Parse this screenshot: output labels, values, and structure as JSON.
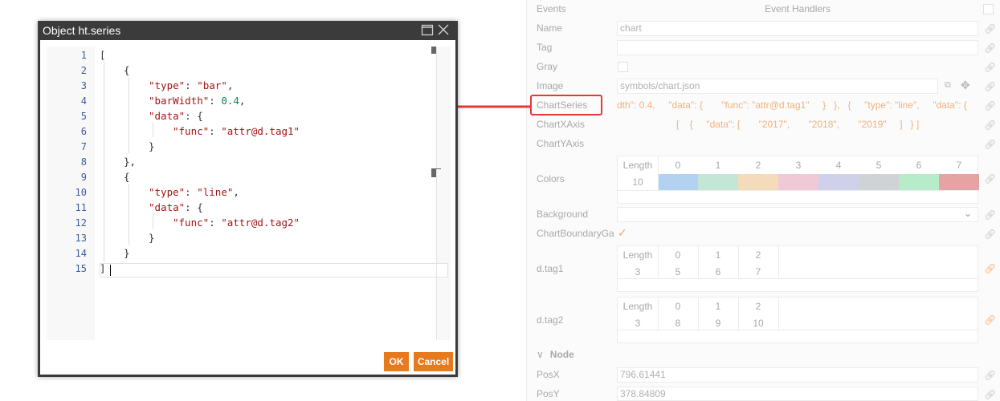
{
  "panel": {
    "events": {
      "label": "Events",
      "header": "Event Handlers"
    },
    "name": {
      "label": "Name",
      "value": "chart"
    },
    "tag": {
      "label": "Tag",
      "value": ""
    },
    "gray": {
      "label": "Gray"
    },
    "image": {
      "label": "Image",
      "value": "symbols/chart.json"
    },
    "chart_series": {
      "label": "ChartSeries",
      "line1": "dth\": 0.4,     \"data\": {       \"func\": \"attr@d.tag1\"     }   },   {     \"type\": \"line\",     \"data\": {",
      "line2": "[    {     \"data\": [       \"2017\",       \"2018\",       \"2019\"     ]   } ]"
    },
    "chart_x_axis": {
      "label": "ChartXAxis"
    },
    "chart_y_axis": {
      "label": "ChartYAxis"
    },
    "colors": {
      "label": "Colors",
      "length_header": "Length",
      "length_value": "10",
      "indices": [
        "0",
        "1",
        "2",
        "3",
        "4",
        "5",
        "6",
        "7"
      ],
      "swatches": [
        "#b3d1f1",
        "#c3e6d6",
        "#f4dcbb",
        "#f0c9d6",
        "#cfd0ea",
        "#d0d3d6",
        "#b6ecc9",
        "#e6a3a3"
      ]
    },
    "background": {
      "label": "Background"
    },
    "chart_boundary": {
      "label": "ChartBoundaryGa",
      "check": "✓"
    },
    "tag1": {
      "label": "d.tag1",
      "headers": [
        "Length",
        "0",
        "1",
        "2"
      ],
      "values": [
        "3",
        "5",
        "6",
        "7"
      ]
    },
    "tag2": {
      "label": "d.tag2",
      "headers": [
        "Length",
        "0",
        "1",
        "2"
      ],
      "values": [
        "3",
        "8",
        "9",
        "10"
      ]
    },
    "node_section": "Node",
    "posx": {
      "label": "PosX",
      "value": "796.61441"
    },
    "posy": {
      "label": "PosY",
      "value": "378.84809"
    }
  },
  "dialog": {
    "title": "Object ht.series",
    "ok_label": "OK",
    "cancel_label": "Cancel",
    "line_numbers": [
      "1",
      "2",
      "3",
      "4",
      "5",
      "6",
      "7",
      "8",
      "9",
      "10",
      "11",
      "12",
      "13",
      "14",
      "15"
    ],
    "code": {
      "l1": "[",
      "l2": "{",
      "l3_key": "\"type\"",
      "l3_val": "\"bar\"",
      "l4_key": "\"barWidth\"",
      "l4_val": "0.4",
      "l5_key": "\"data\"",
      "l5_rest": ": {",
      "l6_key": "\"func\"",
      "l6_val": "\"attr@d.tag1\"",
      "l7": "}",
      "l8": "},",
      "l9": "{",
      "l10_key": "\"type\"",
      "l10_val": "\"line\"",
      "l11_key": "\"data\"",
      "l11_rest": ": {",
      "l12_key": "\"func\"",
      "l12_val": "\"attr@d.tag2\"",
      "l13": "}",
      "l14": "}",
      "l15": "]"
    }
  },
  "colors": {
    "arrow": "#e53935",
    "button": "#e67a1e",
    "titlebar": "#3b3b3b"
  }
}
